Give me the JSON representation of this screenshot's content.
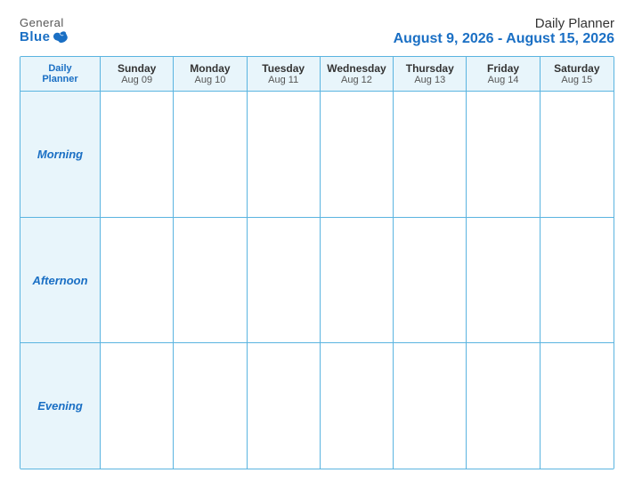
{
  "logo": {
    "general": "General",
    "blue": "Blue"
  },
  "title": {
    "main": "Daily Planner",
    "date_range": "August 9, 2026 - August 15, 2026"
  },
  "header_row": {
    "label_top": "Daily",
    "label_bottom": "Planner",
    "days": [
      {
        "name": "Sunday",
        "date": "Aug 09"
      },
      {
        "name": "Monday",
        "date": "Aug 10"
      },
      {
        "name": "Tuesday",
        "date": "Aug 11"
      },
      {
        "name": "Wednesday",
        "date": "Aug 12"
      },
      {
        "name": "Thursday",
        "date": "Aug 13"
      },
      {
        "name": "Friday",
        "date": "Aug 14"
      },
      {
        "name": "Saturday",
        "date": "Aug 15"
      }
    ]
  },
  "rows": [
    {
      "label": "Morning"
    },
    {
      "label": "Afternoon"
    },
    {
      "label": "Evening"
    }
  ]
}
